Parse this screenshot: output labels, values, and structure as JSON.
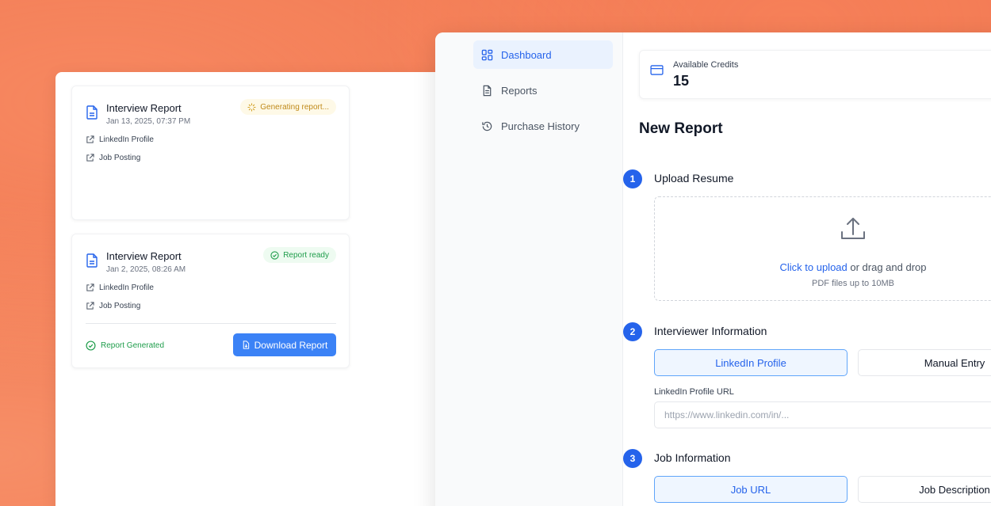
{
  "reports": [
    {
      "title": "Interview Report",
      "date": "Jan 13, 2025, 07:37 PM",
      "status": "Generating report...",
      "links": [
        "LinkedIn Profile",
        "Job Posting"
      ]
    },
    {
      "title": "Interview Report",
      "date": "Jan 2, 2025, 08:26 AM",
      "status": "Report ready",
      "links": [
        "LinkedIn Profile",
        "Job Posting"
      ],
      "generated_label": "Report Generated",
      "download_label": "Download Report"
    }
  ],
  "sidebar": {
    "items": [
      {
        "label": "Dashboard",
        "icon": "grid-icon"
      },
      {
        "label": "Reports",
        "icon": "file-text-icon"
      },
      {
        "label": "Purchase History",
        "icon": "history-icon"
      }
    ]
  },
  "credits": {
    "label": "Available Credits",
    "value": "15"
  },
  "new_report": {
    "title": "New Report",
    "step1": {
      "num": "1",
      "title": "Upload Resume",
      "click_text": "Click to upload",
      "drag_text": " or drag and drop",
      "hint": "PDF files up to 10MB"
    },
    "step2": {
      "num": "2",
      "title": "Interviewer Information",
      "option_a": "LinkedIn Profile",
      "option_b": "Manual Entry",
      "field_label": "LinkedIn Profile URL",
      "field_placeholder": "https://www.linkedin.com/in/..."
    },
    "step3": {
      "num": "3",
      "title": "Job Information",
      "option_a": "Job URL",
      "option_b": "Job Description"
    }
  },
  "colors": {
    "accent": "#2563eb",
    "background": "#f27a53",
    "success": "#1f9d4b",
    "warning": "#c08a1a"
  }
}
